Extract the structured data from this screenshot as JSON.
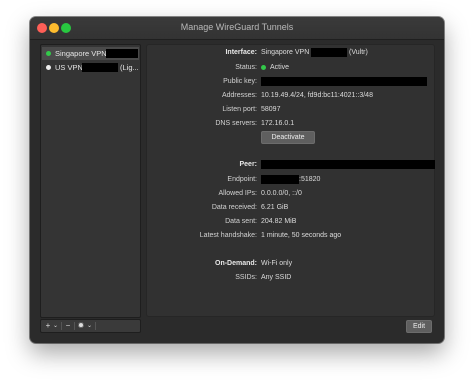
{
  "window": {
    "title": "Manage WireGuard Tunnels"
  },
  "sidebar": {
    "tunnels": [
      {
        "name": "Singapore VPN",
        "status_color": "#33c94a",
        "suffix": ""
      },
      {
        "name": "US VPN",
        "status_color": "#ededed",
        "suffix": "(Lig..."
      }
    ],
    "toolbar": {
      "add_label": "+",
      "add_chevron": "⌄",
      "remove_label": "−",
      "gear_label": "✹",
      "gear_chevron": "⌄"
    }
  },
  "interface": {
    "header_label": "Interface:",
    "name_prefix": "Singapore VPN",
    "name_suffix": "(Vultr)",
    "status_label": "Status:",
    "status_value": "Active",
    "status_color": "#33c94a",
    "public_key_label": "Public key:",
    "addresses_label": "Addresses:",
    "addresses_value": "10.19.49.4/24, fd9d:bc11:4021::3/48",
    "listen_port_label": "Listen port:",
    "listen_port_value": "58097",
    "dns_label": "DNS servers:",
    "dns_value": "172.16.0.1",
    "deactivate_label": "Deactivate"
  },
  "peer": {
    "header_label": "Peer:",
    "endpoint_label": "Endpoint:",
    "endpoint_port": ":51820",
    "allowed_ips_label": "Allowed IPs:",
    "allowed_ips_value": "0.0.0.0/0, ::/0",
    "data_received_label": "Data received:",
    "data_received_value": "6.21 GiB",
    "data_sent_label": "Data sent:",
    "data_sent_value": "204.82 MiB",
    "handshake_label": "Latest handshake:",
    "handshake_value": "1 minute, 50 seconds ago"
  },
  "on_demand": {
    "header_label": "On-Demand:",
    "header_value": "Wi-Fi only",
    "ssids_label": "SSIDs:",
    "ssids_value": "Any SSID"
  },
  "footer": {
    "edit_label": "Edit"
  }
}
